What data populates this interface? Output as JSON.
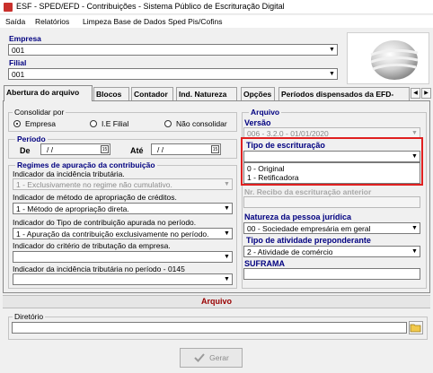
{
  "window": {
    "title": "ESF - SPED/EFD - Contribuições - Sistema Público de Escrituração Digital"
  },
  "menu": {
    "items": [
      "Saída",
      "Relatórios",
      "Limpeza Base de Dados Sped Pis/Cofins"
    ]
  },
  "empresa": {
    "label": "Empresa",
    "value": "001"
  },
  "filial": {
    "label": "Filial",
    "value": "001"
  },
  "tabs": [
    "Abertura do arquivo",
    "Blocos",
    "Contador",
    "Ind. Natureza",
    "Opções",
    "Períodos dispensados da EFD-"
  ],
  "consolidar": {
    "label": "Consolidar por",
    "options": [
      "Empresa",
      "I.E Filial",
      "Não consolidar"
    ],
    "selected": "Empresa"
  },
  "periodo": {
    "label": "Período",
    "de_label": "De",
    "de_value": "/ /",
    "ate_label": "Até",
    "ate_value": "/ /"
  },
  "regimes": {
    "label": "Regimes de apuração da contribuição",
    "incidencia_label": "Indicador da incidência tributária.",
    "incidencia_value": "1 - Exclusivamente no regime não cumulativo.",
    "metodo_label": "Indicador de método de apropriação de créditos.",
    "metodo_value": "1 - Método de apropriação direta.",
    "tipo_label": "Indicador do Tipo de contribuição apurada no período.",
    "tipo_value": "1 - Apuração da contribuição exclusivamente no período.",
    "criterio_label": "Indicador do critério de tributação da empresa.",
    "criterio_value": "",
    "incidencia0145_label": "Indicador da incidência tributária no período  - 0145",
    "incidencia0145_value": ""
  },
  "arquivo": {
    "label": "Arquivo",
    "versao_label": "Versão",
    "versao_value": "006 - 3.2.0 - 01/01/2020",
    "tipo_escrituracao_label": "Tipo de escrituração",
    "tipo_escrituracao_value": "",
    "tipo_escrituracao_options": [
      "0 - Original",
      "1 - Retificadora"
    ],
    "recibo_label": "Nr. Recibo da escrituração anterior",
    "recibo_value": "",
    "natureza_label": "Natureza da pessoa jurídica",
    "natureza_value": "00 - Sociedade empresária em geral",
    "atividade_label": "Tipo de atividade preponderante",
    "atividade_value": "2 - Atividade de comércio",
    "suframa_label": "SUFRAMA",
    "suframa_value": ""
  },
  "arquivo_section": {
    "title": "Arquivo",
    "diretorio_label": "Diretório",
    "diretorio_value": ""
  },
  "gerar_button": {
    "label": "Gerar"
  },
  "colors": {
    "highlight_border": "#e02020",
    "section_header_text": "#990000",
    "title_text": "#000080"
  },
  "icons": [
    "app-icon",
    "folder-icon",
    "check-icon",
    "calendar-icon",
    "chevron-down-icon",
    "logo-graphic"
  ]
}
